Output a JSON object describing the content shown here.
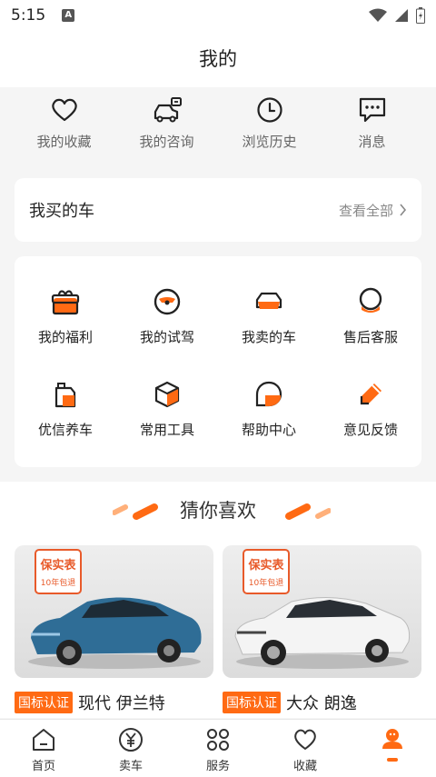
{
  "status": {
    "time": "5:15",
    "notif_letter": "A"
  },
  "header": {
    "title": "我的"
  },
  "quick": [
    {
      "label": "我的收藏",
      "icon": "heart-icon"
    },
    {
      "label": "我的咨询",
      "icon": "consult-icon"
    },
    {
      "label": "浏览历史",
      "icon": "clock-icon"
    },
    {
      "label": "消息",
      "icon": "message-icon"
    }
  ],
  "bought": {
    "title": "我买的车",
    "view_all": "查看全部"
  },
  "services": [
    {
      "label": "我的福利",
      "icon": "gift-icon"
    },
    {
      "label": "我的试驾",
      "icon": "steering-wheel-icon"
    },
    {
      "label": "我卖的车",
      "icon": "car-icon"
    },
    {
      "label": "售后客服",
      "icon": "headset-icon"
    },
    {
      "label": "优信养车",
      "icon": "oil-can-icon"
    },
    {
      "label": "常用工具",
      "icon": "box-icon"
    },
    {
      "label": "帮助中心",
      "icon": "help-bubble-icon"
    },
    {
      "label": "意见反馈",
      "icon": "pen-icon"
    }
  ],
  "guess": {
    "title": "猜你喜欢",
    "cars": [
      {
        "badge": "国标认证",
        "name": "现代 伊兰特",
        "stamp_top": "保实表",
        "stamp_bottom": "10年包退"
      },
      {
        "badge": "国标认证",
        "name": "大众 朗逸",
        "stamp_top": "保实表",
        "stamp_bottom": "10年包退"
      }
    ]
  },
  "nav": [
    {
      "label": "首页",
      "icon": "home-icon"
    },
    {
      "label": "卖车",
      "icon": "yuan-icon"
    },
    {
      "label": "服务",
      "icon": "grid-icon"
    },
    {
      "label": "收藏",
      "icon": "heart-outline-icon"
    },
    {
      "label": "",
      "icon": "profile-icon",
      "active": true
    }
  ],
  "colors": {
    "accent": "#ff6a13",
    "text": "#222222",
    "muted": "#888888"
  }
}
